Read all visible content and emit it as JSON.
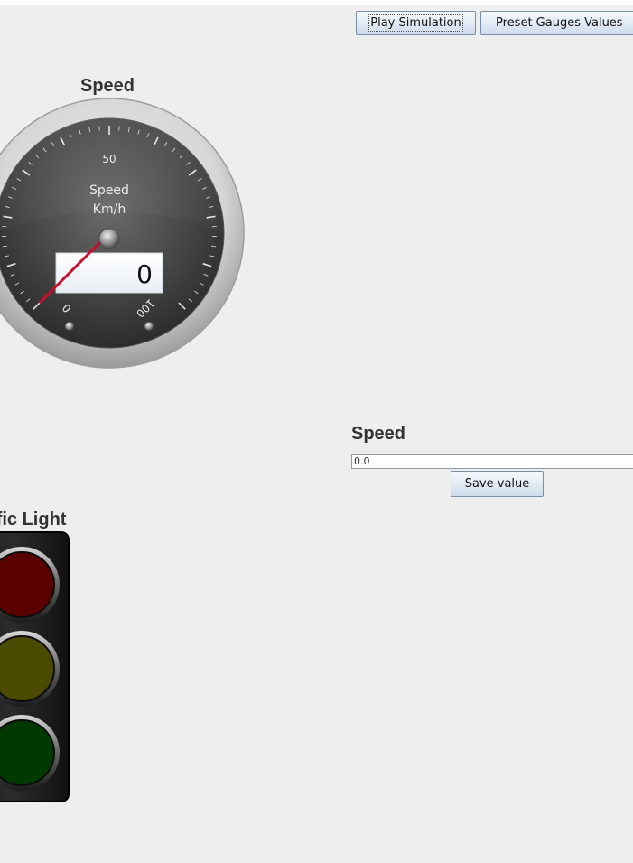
{
  "toolbar": {
    "play_label": "Play Simulation",
    "preset_label": "Preset Gauges Values"
  },
  "speed_gauge": {
    "title": "Speed",
    "face_title": "Speed",
    "unit": "Km/h",
    "min_label": "0",
    "mid_label": "50",
    "max_label": "100",
    "value": 0,
    "display_value": "0"
  },
  "speed_editor": {
    "title": "Speed",
    "field_value": "0.0",
    "save_label": "Save value"
  },
  "traffic_light": {
    "title": "Traffic Light",
    "lamps": [
      "red",
      "yellow",
      "green"
    ],
    "active_lamp": "none",
    "colors": {
      "red": "#5a0000",
      "yellow": "#4a4a00",
      "green": "#003a00"
    }
  }
}
